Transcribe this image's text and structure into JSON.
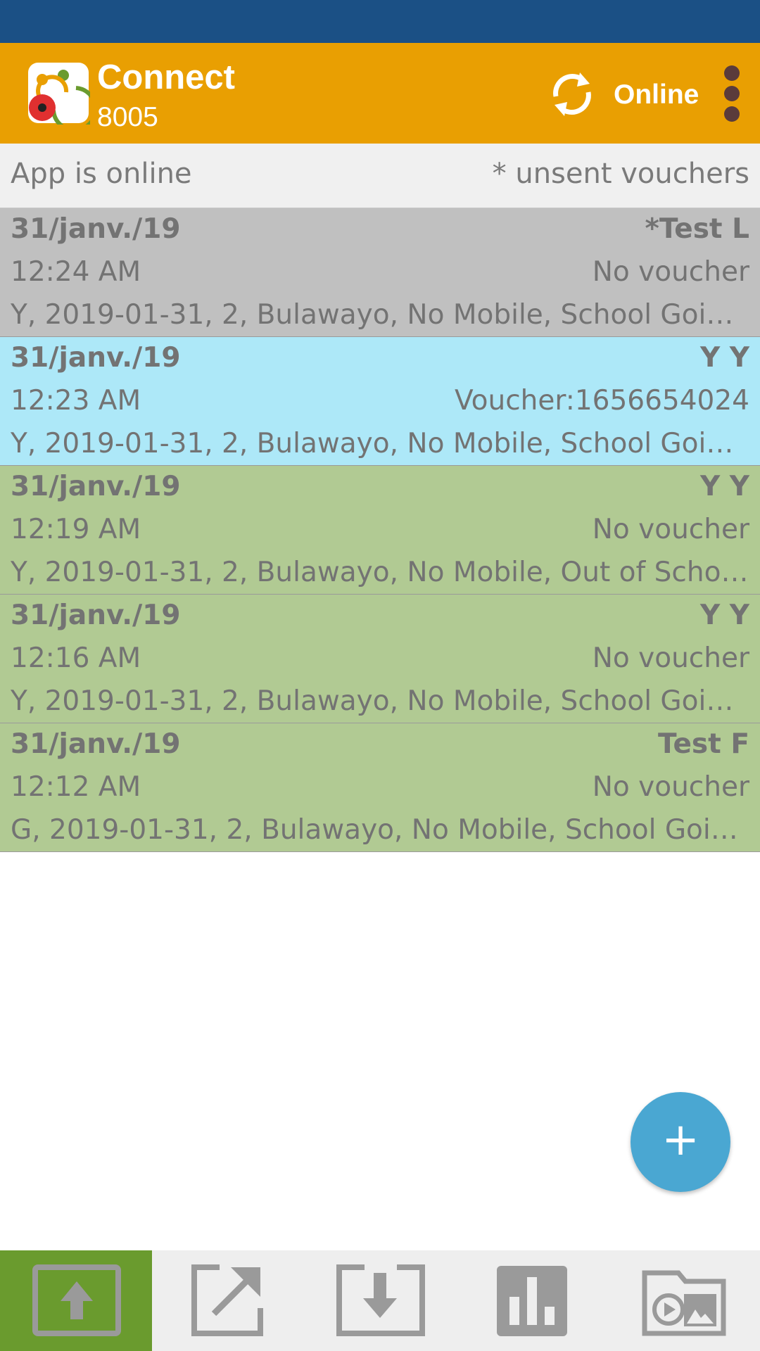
{
  "app_bar": {
    "title": "Connect",
    "subtitle": "8005",
    "status_label": "Online",
    "colors": {
      "background": "#e99f02",
      "status_bar": "#1b5085"
    }
  },
  "info_bar": {
    "left_text": "App is online",
    "right_text": "* unsent vouchers"
  },
  "records": [
    {
      "date": "31/janv./19",
      "name": "*Test L",
      "time": "12:24 AM",
      "voucher": "No voucher",
      "details": "Y, 2019-01-31, 2, Bulawayo, No Mobile, School Going,...",
      "color": "#c0c0c0"
    },
    {
      "date": "31/janv./19",
      "name": "Y Y",
      "time": "12:23 AM",
      "voucher": "Voucher:1656654024",
      "details": "Y, 2019-01-31, 2, Bulawayo, No Mobile, School Going,...",
      "color": "#ade8f8"
    },
    {
      "date": "31/janv./19",
      "name": "Y Y",
      "time": "12:19 AM",
      "voucher": "No voucher",
      "details": "Y, 2019-01-31, 2, Bulawayo, No Mobile, Out of School...",
      "color": "#b1ca93"
    },
    {
      "date": "31/janv./19",
      "name": "Y Y",
      "time": "12:16 AM",
      "voucher": "No voucher",
      "details": "Y, 2019-01-31, 2, Bulawayo, No Mobile, School Going,...",
      "color": "#b1ca93"
    },
    {
      "date": "31/janv./19",
      "name": "Test F",
      "time": "12:12 AM",
      "voucher": "No voucher",
      "details": "G, 2019-01-31, 2, Bulawayo, No Mobile, School Going...",
      "color": "#b1ca93"
    }
  ],
  "fab": {
    "label": "+",
    "icon": "plus-icon",
    "color": "#4aa7d2"
  },
  "bottom_nav": [
    {
      "icon": "upload-icon",
      "active": true,
      "color": "#6a9b2e"
    },
    {
      "icon": "open-external-icon",
      "active": false
    },
    {
      "icon": "download-icon",
      "active": false
    },
    {
      "icon": "bar-chart-icon",
      "active": false
    },
    {
      "icon": "media-folder-icon",
      "active": false
    }
  ]
}
